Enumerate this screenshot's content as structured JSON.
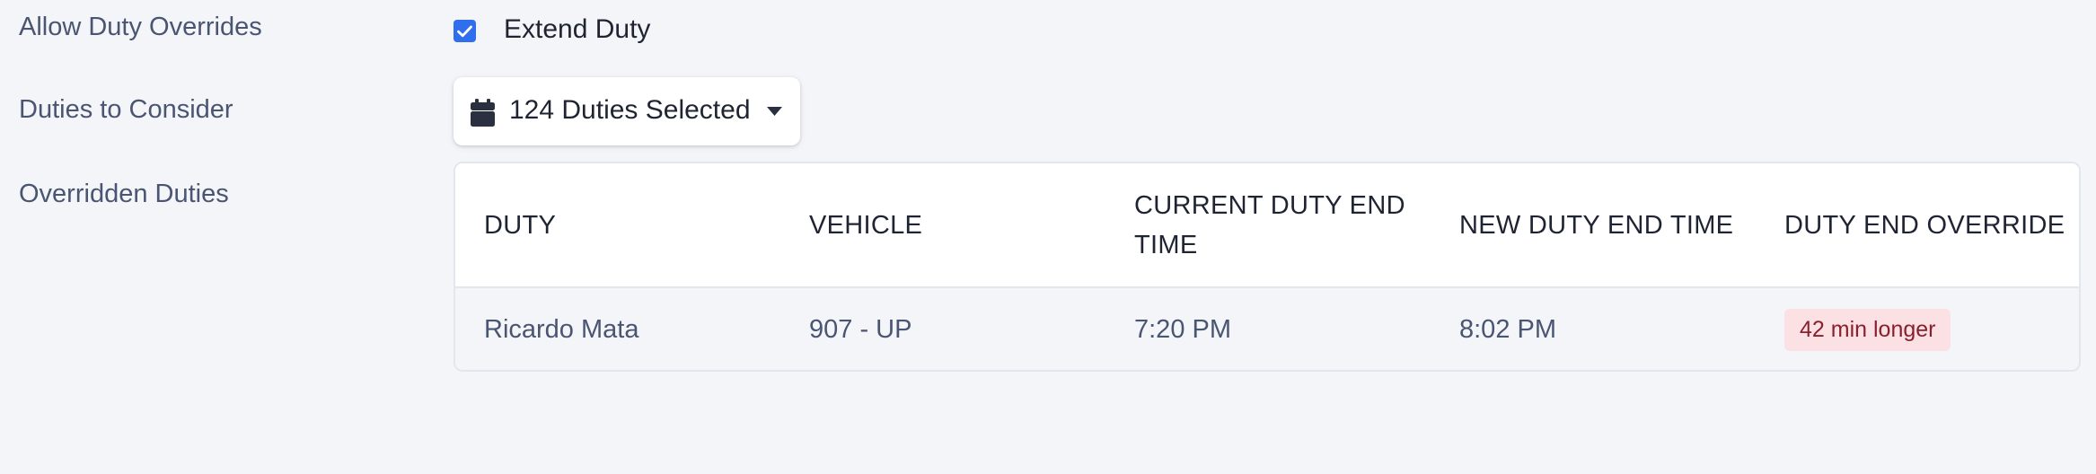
{
  "settings": {
    "allow_overrides": {
      "label": "Allow Duty Overrides",
      "checkbox_label": "Extend Duty",
      "checked": true
    },
    "duties_to_consider": {
      "label": "Duties to Consider",
      "selected_text": "124 Duties Selected",
      "icon": "calendar-icon"
    },
    "overridden_duties": {
      "label": "Overridden Duties"
    }
  },
  "table": {
    "headers": [
      "DUTY",
      "VEHICLE",
      "CURRENT DUTY END TIME",
      "NEW DUTY END TIME",
      "DUTY END OVERRIDE"
    ],
    "rows": [
      {
        "duty": "Ricardo Mata",
        "vehicle": "907 - UP",
        "current_end": "7:20 PM",
        "new_end": "8:02 PM",
        "override": "42 min longer"
      }
    ]
  },
  "colors": {
    "accent": "#2f6fed",
    "badge_bg": "#fbe1e4",
    "badge_text": "#8a1f2e"
  }
}
